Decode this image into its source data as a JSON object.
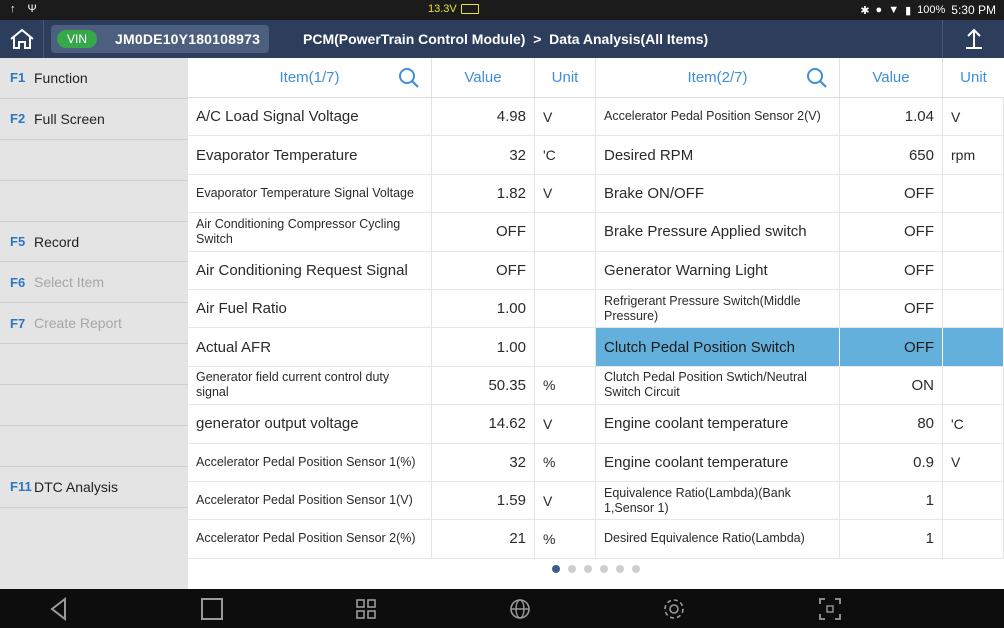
{
  "status": {
    "voltage": "13.3V",
    "battery_percent": "100%",
    "time": "5:30 PM"
  },
  "header": {
    "vin_label": "VIN",
    "vin": "JM0DE10Y180108973",
    "breadcrumb": "PCM(PowerTrain Control Module)  >  Data Analysis(All Items)"
  },
  "sidebar": {
    "items": [
      {
        "key": "F1",
        "label": "Function",
        "enabled": true
      },
      {
        "key": "F2",
        "label": "Full Screen",
        "enabled": true
      },
      {
        "key": "",
        "label": "",
        "enabled": true
      },
      {
        "key": "",
        "label": "",
        "enabled": true
      },
      {
        "key": "F5",
        "label": "Record",
        "enabled": true
      },
      {
        "key": "F6",
        "label": "Select Item",
        "enabled": false
      },
      {
        "key": "F7",
        "label": "Create Report",
        "enabled": false
      },
      {
        "key": "",
        "label": "",
        "enabled": true
      },
      {
        "key": "",
        "label": "",
        "enabled": true
      },
      {
        "key": "",
        "label": "",
        "enabled": true
      },
      {
        "key": "F11",
        "label": "DTC Analysis",
        "enabled": true
      },
      {
        "key": "",
        "label": "",
        "enabled": true
      }
    ]
  },
  "table": {
    "left_header": {
      "item": "Item(1/7)",
      "value": "Value",
      "unit": "Unit"
    },
    "right_header": {
      "item": "Item(2/7)",
      "value": "Value",
      "unit": "Unit"
    },
    "rows": [
      {
        "l_item": "A/C Load Signal Voltage",
        "l_value": "4.98",
        "l_unit": "V",
        "r_item": "Accelerator Pedal Position Sensor 2(V)",
        "r_value": "1.04",
        "r_unit": "V"
      },
      {
        "l_item": "Evaporator Temperature",
        "l_value": "32",
        "l_unit": "'C",
        "r_item": "Desired RPM",
        "r_value": "650",
        "r_unit": "rpm"
      },
      {
        "l_item": "Evaporator Temperature Signal Voltage",
        "l_value": "1.82",
        "l_unit": "V",
        "r_item": "Brake ON/OFF",
        "r_value": "OFF",
        "r_unit": ""
      },
      {
        "l_item": "Air Conditioning Compressor Cycling Switch",
        "l_value": "OFF",
        "l_unit": "",
        "r_item": "Brake Pressure Applied switch",
        "r_value": "OFF",
        "r_unit": ""
      },
      {
        "l_item": "Air Conditioning Request Signal",
        "l_value": "OFF",
        "l_unit": "",
        "r_item": "Generator Warning Light",
        "r_value": "OFF",
        "r_unit": ""
      },
      {
        "l_item": "Air Fuel Ratio",
        "l_value": "1.00",
        "l_unit": "",
        "r_item": "Refrigerant Pressure Switch(Middle Pressure)",
        "r_value": "OFF",
        "r_unit": ""
      },
      {
        "l_item": "Actual AFR",
        "l_value": "1.00",
        "l_unit": "",
        "r_item": "Clutch Pedal Position Switch",
        "r_value": "OFF",
        "r_unit": ""
      },
      {
        "l_item": "Generator field current control duty signal",
        "l_value": "50.35",
        "l_unit": "%",
        "r_item": "Clutch Pedal Position Swtich/Neutral Switch Circuit",
        "r_value": "ON",
        "r_unit": ""
      },
      {
        "l_item": "generator output voltage",
        "l_value": "14.62",
        "l_unit": "V",
        "r_item": "Engine coolant temperature",
        "r_value": "80",
        "r_unit": "'C"
      },
      {
        "l_item": "Accelerator Pedal Position Sensor 1(%)",
        "l_value": "32",
        "l_unit": "%",
        "r_item": "Engine coolant temperature",
        "r_value": "0.9",
        "r_unit": "V"
      },
      {
        "l_item": "Accelerator Pedal Position Sensor 1(V)",
        "l_value": "1.59",
        "l_unit": "V",
        "r_item": "Equivalence Ratio(Lambda)(Bank 1,Sensor 1)",
        "r_value": "1",
        "r_unit": ""
      },
      {
        "l_item": "Accelerator Pedal Position Sensor 2(%)",
        "l_value": "21",
        "l_unit": "%",
        "r_item": "Desired Equivalence Ratio(Lambda)",
        "r_value": "1",
        "r_unit": ""
      }
    ]
  },
  "pager": {
    "pages": 6,
    "current": 1
  },
  "icons": {
    "home": "home-icon",
    "export": "export-icon",
    "search": "search-icon",
    "back": "back-icon",
    "recent": "recent-apps-icon",
    "apps": "apps-grid-icon",
    "browser": "globe-icon",
    "settings": "gear-icon",
    "screenshot": "screenshot-icon"
  }
}
